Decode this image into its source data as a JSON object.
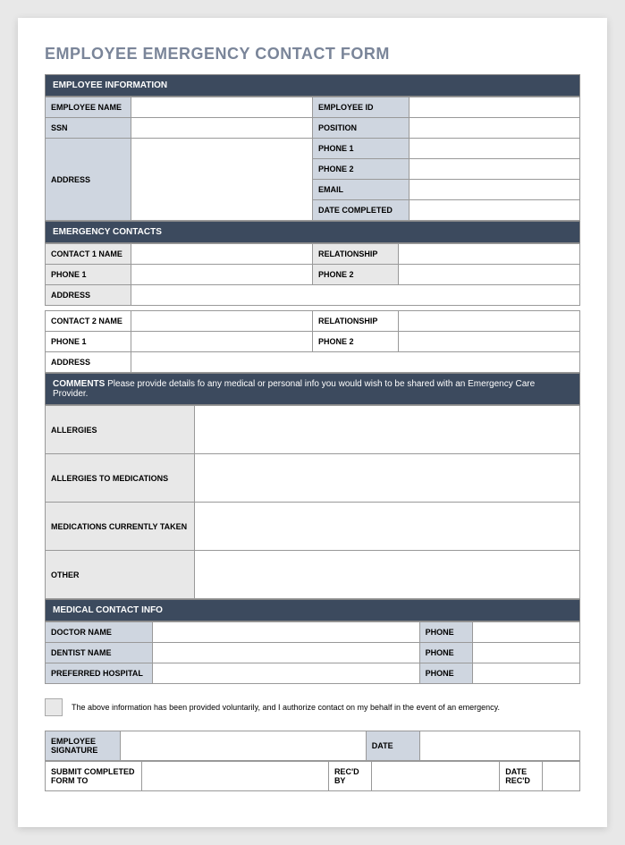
{
  "title": "EMPLOYEE EMERGENCY CONTACT FORM",
  "sections": {
    "employeeInfo": {
      "header": "EMPLOYEE INFORMATION",
      "labels": {
        "employeeName": "EMPLOYEE NAME",
        "employeeId": "EMPLOYEE ID",
        "ssn": "SSN",
        "position": "POSITION",
        "address": "ADDRESS",
        "phone1": "PHONE 1",
        "phone2": "PHONE 2",
        "email": "EMAIL",
        "dateCompleted": "DATE COMPLETED"
      }
    },
    "emergencyContacts": {
      "header": "EMERGENCY CONTACTS",
      "labels": {
        "contact1Name": "CONTACT 1 NAME",
        "contact2Name": "CONTACT 2 NAME",
        "relationship": "RELATIONSHIP",
        "phone1": "PHONE 1",
        "phone2": "PHONE 2",
        "address": "ADDRESS"
      }
    },
    "comments": {
      "headerBold": "COMMENTS",
      "headerText": " Please provide details fo any medical or personal info you would wish to be shared with an Emergency Care Provider.",
      "labels": {
        "allergies": "ALLERGIES",
        "allergiesToMedications": "ALLERGIES TO MEDICATIONS",
        "medicationsCurrentlyTaken": "MEDICATIONS CURRENTLY TAKEN",
        "other": "OTHER"
      }
    },
    "medicalContactInfo": {
      "header": "MEDICAL CONTACT INFO",
      "labels": {
        "doctorName": "DOCTOR NAME",
        "dentistName": "DENTIST NAME",
        "preferredHospital": "PREFERRED HOSPITAL",
        "phone": "PHONE"
      }
    },
    "authorization": {
      "text": "The above information has been provided voluntarily, and I authorize contact on my behalf in the event of an emergency."
    },
    "signature": {
      "labels": {
        "employeeSignature": "EMPLOYEE SIGNATURE",
        "date": "DATE",
        "submitCompletedFormTo": "SUBMIT COMPLETED FORM TO",
        "recdBy": "REC'D BY",
        "dateRecd": "DATE REC'D"
      }
    }
  }
}
